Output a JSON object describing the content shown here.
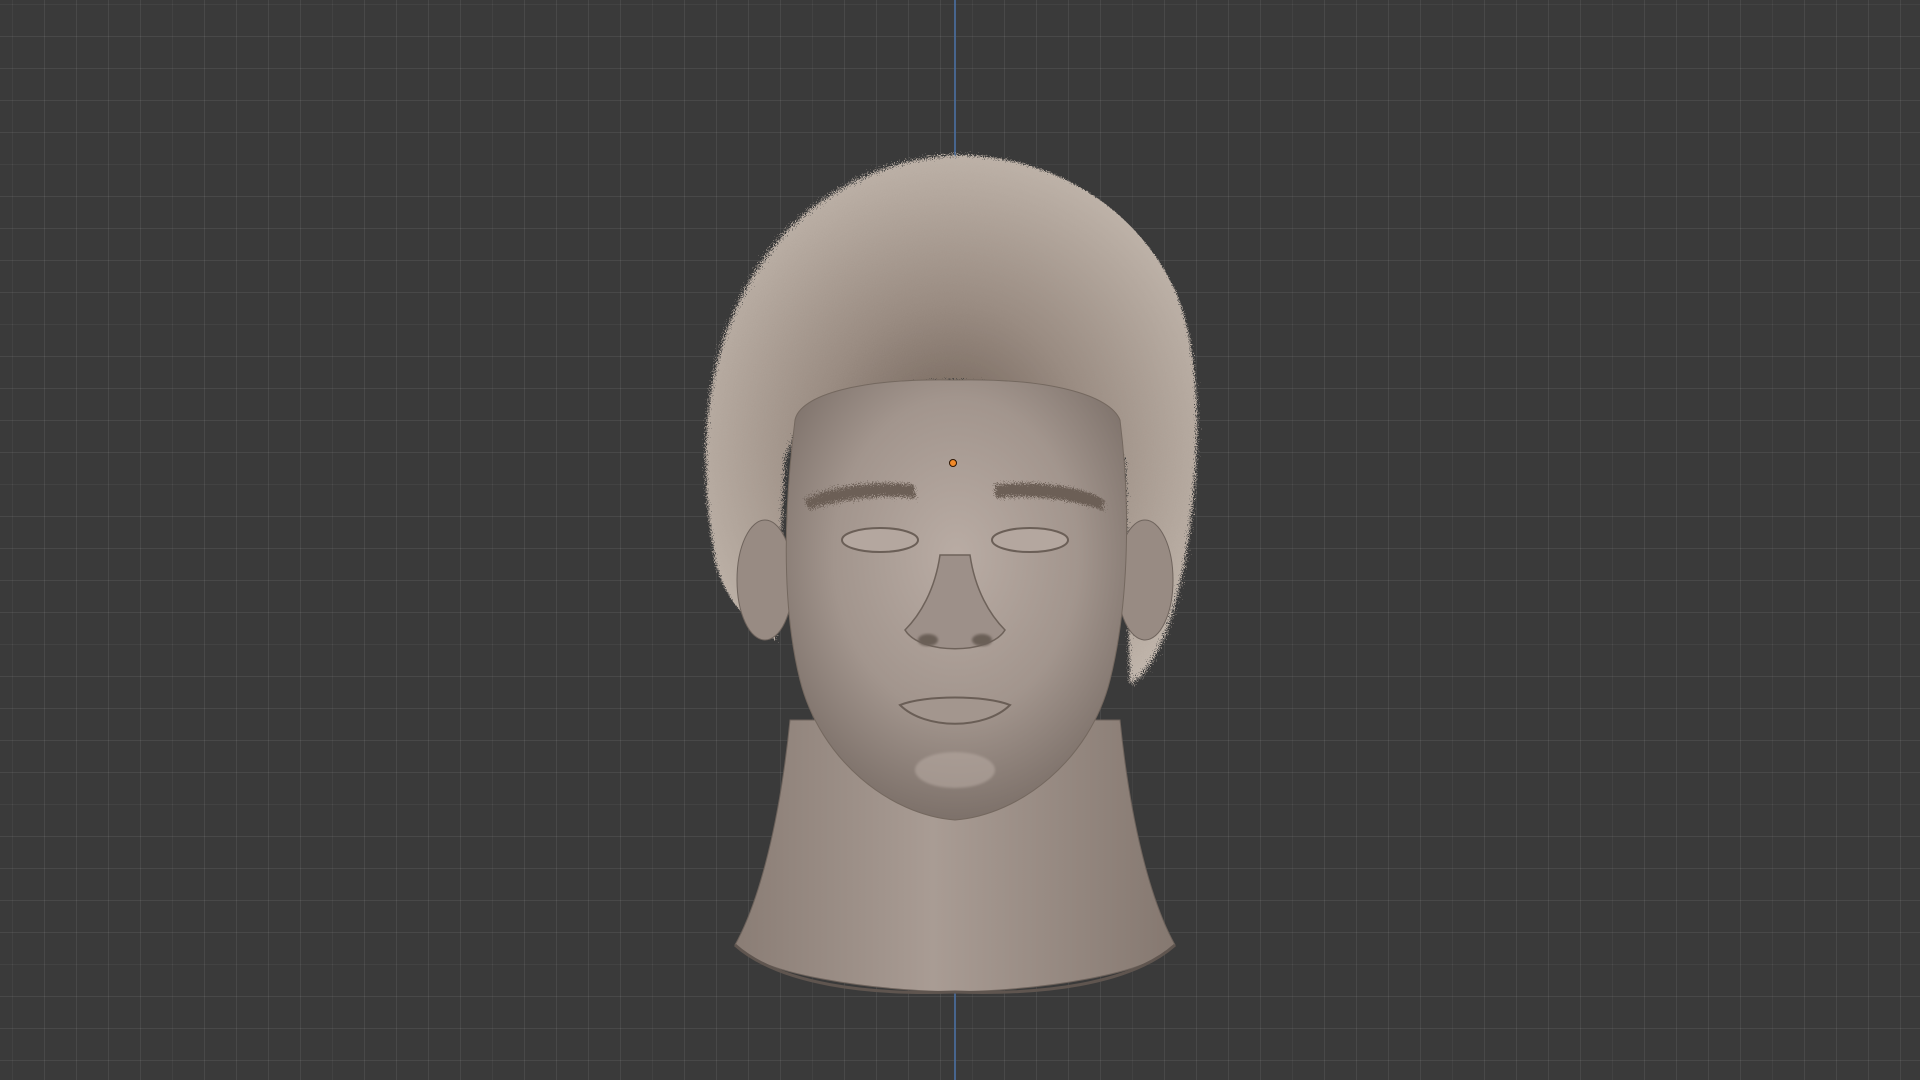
{
  "app": "3D viewport",
  "viewport": {
    "background": "#3a3a3a",
    "grid_color": "#474747",
    "z_axis_color": "#4a6d9e"
  },
  "object": {
    "icon": "head-sculpt-icon",
    "mesh_color": "#a89b93",
    "hair_color": "#b2a69c",
    "origin_color": "#f08a2a"
  }
}
